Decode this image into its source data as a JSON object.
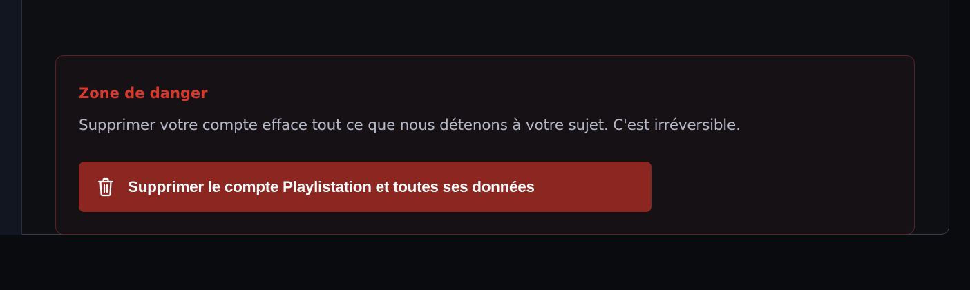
{
  "danger_zone": {
    "title": "Zone de danger",
    "description": "Supprimer votre compte efface tout ce que nous détenons à votre sujet. C'est irréversible.",
    "delete_button": {
      "label": "Supprimer le compte Playlistation et toutes ses données",
      "icon": "trash-icon"
    }
  },
  "colors": {
    "page_background": "#0a0b0e",
    "panel_background": "#0e0f13",
    "card_background": "#161115",
    "card_border": "#5c2125",
    "danger_title": "#d63a2e",
    "description_text": "#b5b8c6",
    "button_background": "#8b2620",
    "button_text": "#ffffff"
  }
}
